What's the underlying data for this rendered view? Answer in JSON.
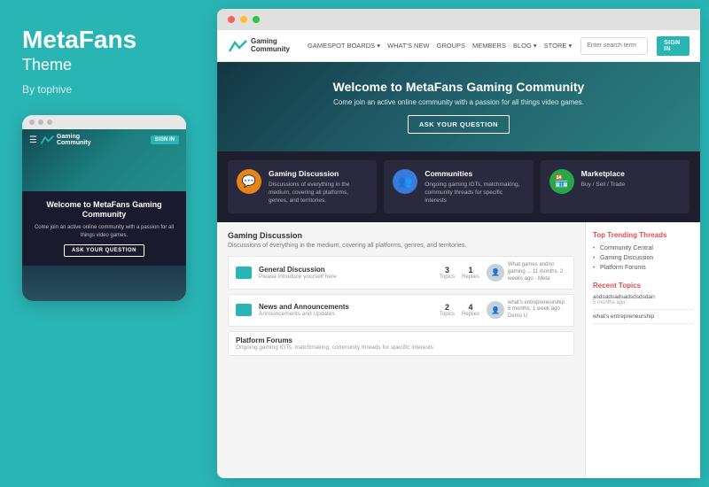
{
  "left": {
    "brand": "MetaFans",
    "subtitle": "Theme",
    "author": "By tophive",
    "mobile": {
      "nav": {
        "logo_line1": "Gaming",
        "logo_line2": "Community",
        "signin": "SIGN IN"
      },
      "welcome": "Welcome to MetaFans Gaming Community",
      "desc": "Come join an active online community with a passion for all things video games.",
      "cta": "ASK YOUR QUESTION"
    }
  },
  "browser": {
    "nav": {
      "logo_line1": "Gaming",
      "logo_line2": "Community",
      "links": [
        {
          "label": "GAMESPOT BOARDS ▾"
        },
        {
          "label": "WHAT'S NEW"
        },
        {
          "label": "GROUPS"
        },
        {
          "label": "MEMBERS"
        },
        {
          "label": "BLOG ▾"
        },
        {
          "label": "STORE ▾"
        }
      ],
      "search_placeholder": "Enter search term",
      "signin": "SIGN IN"
    },
    "hero": {
      "title": "Welcome to MetaFans Gaming Community",
      "desc": "Come join an active online community with a passion for all things video games.",
      "cta": "ASK YOUR QUESTION"
    },
    "features": [
      {
        "icon": "💬",
        "color": "orange",
        "title": "Gaming Discussion",
        "desc": "Discussions of everything in the medium, covering all platforms, genres, and territories."
      },
      {
        "icon": "👥",
        "color": "blue",
        "title": "Communities",
        "desc": "Ongoing gaming IGTs, matchmaking, community threads for specific interests"
      },
      {
        "icon": "🏪",
        "color": "green",
        "title": "Marketplace",
        "desc": "Buy / Sell / Trade"
      }
    ],
    "section": {
      "title": "Gaming Discussion",
      "desc": "Discussions of everything in the medium, covering all platforms, genres, and territories."
    },
    "forums": [
      {
        "name": "General Discussion",
        "sub": "Please introduce yourself here",
        "topics": "3",
        "replies": "1",
        "latest_text": "What games and/or gaming ...\n11 months, 2 weeks ago · Meta"
      },
      {
        "name": "News and Announcements",
        "sub": "Announcements and Updates",
        "topics": "2",
        "replies": "4",
        "latest_text": "what's entrepreneurship\n6 months, 1 week ago · Demo U"
      }
    ],
    "platform": {
      "name": "Platform Forums",
      "desc": "Ongoing gaming IGTs, matchmaking, community threads for specific interests"
    },
    "sidebar": {
      "trending_title": "Top Trending Threads",
      "trending_items": [
        "Community Central",
        "Gaming Discussion",
        "Platform Forums"
      ],
      "recent_title": "Recent Topics",
      "recent_items": [
        {
          "text": "asdsadsadsadsdsdsdan",
          "time": "5 months ago"
        },
        {
          "text": "what's entrepreneurship",
          "time": ""
        }
      ]
    }
  }
}
